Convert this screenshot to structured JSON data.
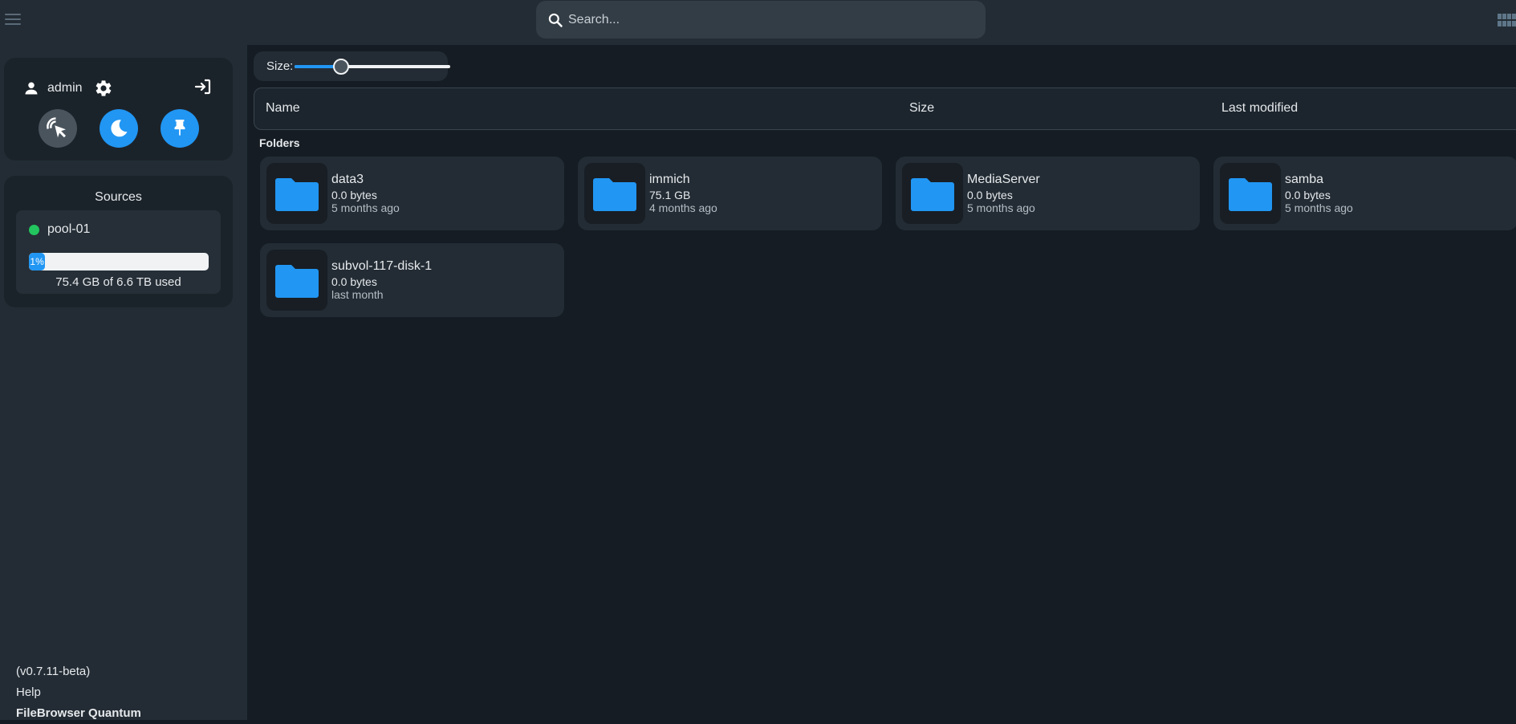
{
  "topbar": {
    "search_placeholder": "Search..."
  },
  "sidebar": {
    "user": {
      "name": "admin"
    },
    "sources": {
      "title": "Sources",
      "items": [
        {
          "name": "pool-01",
          "status_color": "#22c55e",
          "usage_percent": 1,
          "usage_label": "1%",
          "usage_text": "75.4 GB of 6.6 TB used"
        }
      ]
    },
    "footer": {
      "version": "(v0.7.11-beta)",
      "help": "Help",
      "brand": "FileBrowser Quantum"
    }
  },
  "main": {
    "size_label": "Size:",
    "size_slider_value": 0.3,
    "columns": {
      "name": "Name",
      "size": "Size",
      "modified": "Last modified"
    },
    "folders_label": "Folders",
    "folders": [
      {
        "name": "data3",
        "size": "0.0 bytes",
        "modified": "5 months ago"
      },
      {
        "name": "immich",
        "size": "75.1 GB",
        "modified": "4 months ago"
      },
      {
        "name": "MediaServer",
        "size": "0.0 bytes",
        "modified": "5 months ago"
      },
      {
        "name": "samba",
        "size": "0.0 bytes",
        "modified": "5 months ago"
      },
      {
        "name": "subvol-117-disk-1",
        "size": "0.0 bytes",
        "modified": "last month"
      }
    ]
  },
  "colors": {
    "accent": "#2196f3",
    "background": "#151c23",
    "panel": "#232c34"
  },
  "icons": [
    "menu-icon",
    "search-icon",
    "grid-view-icon",
    "user-icon",
    "gear-icon",
    "logout-icon",
    "cursor-click-icon",
    "moon-icon",
    "pin-icon",
    "folder-icon"
  ]
}
